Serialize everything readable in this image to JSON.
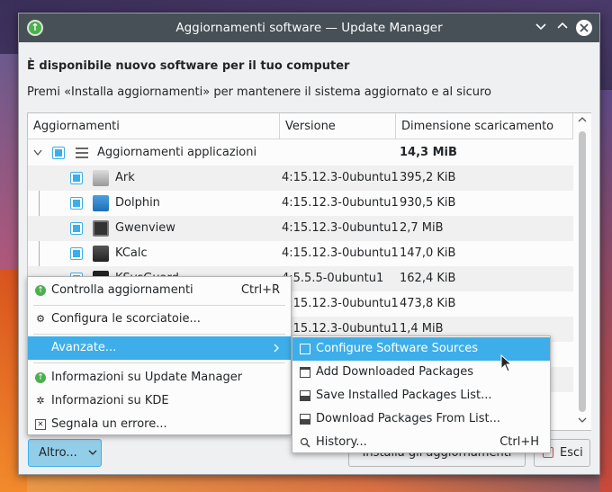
{
  "window": {
    "title": "Aggiornamenti software — Update Manager",
    "minimize_icon": "chevron-down-icon",
    "maximize_icon": "chevron-up-icon",
    "close_icon": "close-icon"
  },
  "header": {
    "heading": "È disponibile nuovo software per il tuo computer",
    "description": "Premi «Installa aggiornamenti» per mantenere il sistema aggiornato e al sicuro"
  },
  "table": {
    "columns": [
      "Aggiornamenti",
      "Versione",
      "Dimensione scaricamento"
    ],
    "group": {
      "name": "Aggiornamenti applicazioni",
      "size": "14,3 MiB",
      "checked": true
    },
    "rows": [
      {
        "name": "Ark",
        "version": "4:15.12.3-0ubuntu1",
        "size": "395,2 KiB",
        "checked": true
      },
      {
        "name": "Dolphin",
        "version": "4:15.12.3-0ubuntu1",
        "size": "930,5 KiB",
        "checked": true
      },
      {
        "name": "Gwenview",
        "version": "4:15.12.3-0ubuntu1",
        "size": "2,7 MiB",
        "checked": true
      },
      {
        "name": "KCalc",
        "version": "4:15.12.3-0ubuntu1",
        "size": "147,0 KiB",
        "checked": true
      },
      {
        "name": "KSysGuard",
        "version": "4:5.5.5-0ubuntu1",
        "size": "162,4 KiB",
        "checked": true
      },
      {
        "name": "",
        "version": "4:15.12.3-0ubuntu1",
        "size": "473,8 KiB",
        "checked": true
      },
      {
        "name": "",
        "version": "4:15.12.3-0ubuntu1",
        "size": "1,4 MiB",
        "checked": true
      }
    ]
  },
  "buttons": {
    "altro": "Altro...",
    "install": "Installa gli aggiornamenti",
    "exit": "Esci"
  },
  "menu": {
    "items": [
      {
        "label": "Controlla aggiornamenti",
        "shortcut": "Ctrl+R",
        "icon": "update-icon"
      },
      {
        "label": "Configura le scorciatoie...",
        "shortcut": "",
        "icon": "shortcuts-icon"
      },
      {
        "label": "Avanzate...",
        "shortcut": "",
        "icon": "",
        "submenu": true
      },
      {
        "label": "Informazioni su Update Manager",
        "shortcut": "",
        "icon": "update-icon"
      },
      {
        "label": "Informazioni su KDE",
        "shortcut": "",
        "icon": "kde-icon"
      },
      {
        "label": "Segnala un errore...",
        "shortcut": "",
        "icon": "bug-icon"
      }
    ]
  },
  "submenu": {
    "items": [
      {
        "label": "Configure Software Sources",
        "shortcut": "",
        "icon": "sources-icon"
      },
      {
        "label": "Add Downloaded Packages",
        "shortcut": "",
        "icon": "folder-icon"
      },
      {
        "label": "Save Installed Packages List...",
        "shortcut": "",
        "icon": "save-icon"
      },
      {
        "label": "Download Packages From List...",
        "shortcut": "",
        "icon": "save-icon"
      },
      {
        "label": "History...",
        "shortcut": "Ctrl+H",
        "icon": "search-icon"
      }
    ]
  },
  "colors": {
    "accent": "#3daee9",
    "titlebar": "#475057"
  }
}
